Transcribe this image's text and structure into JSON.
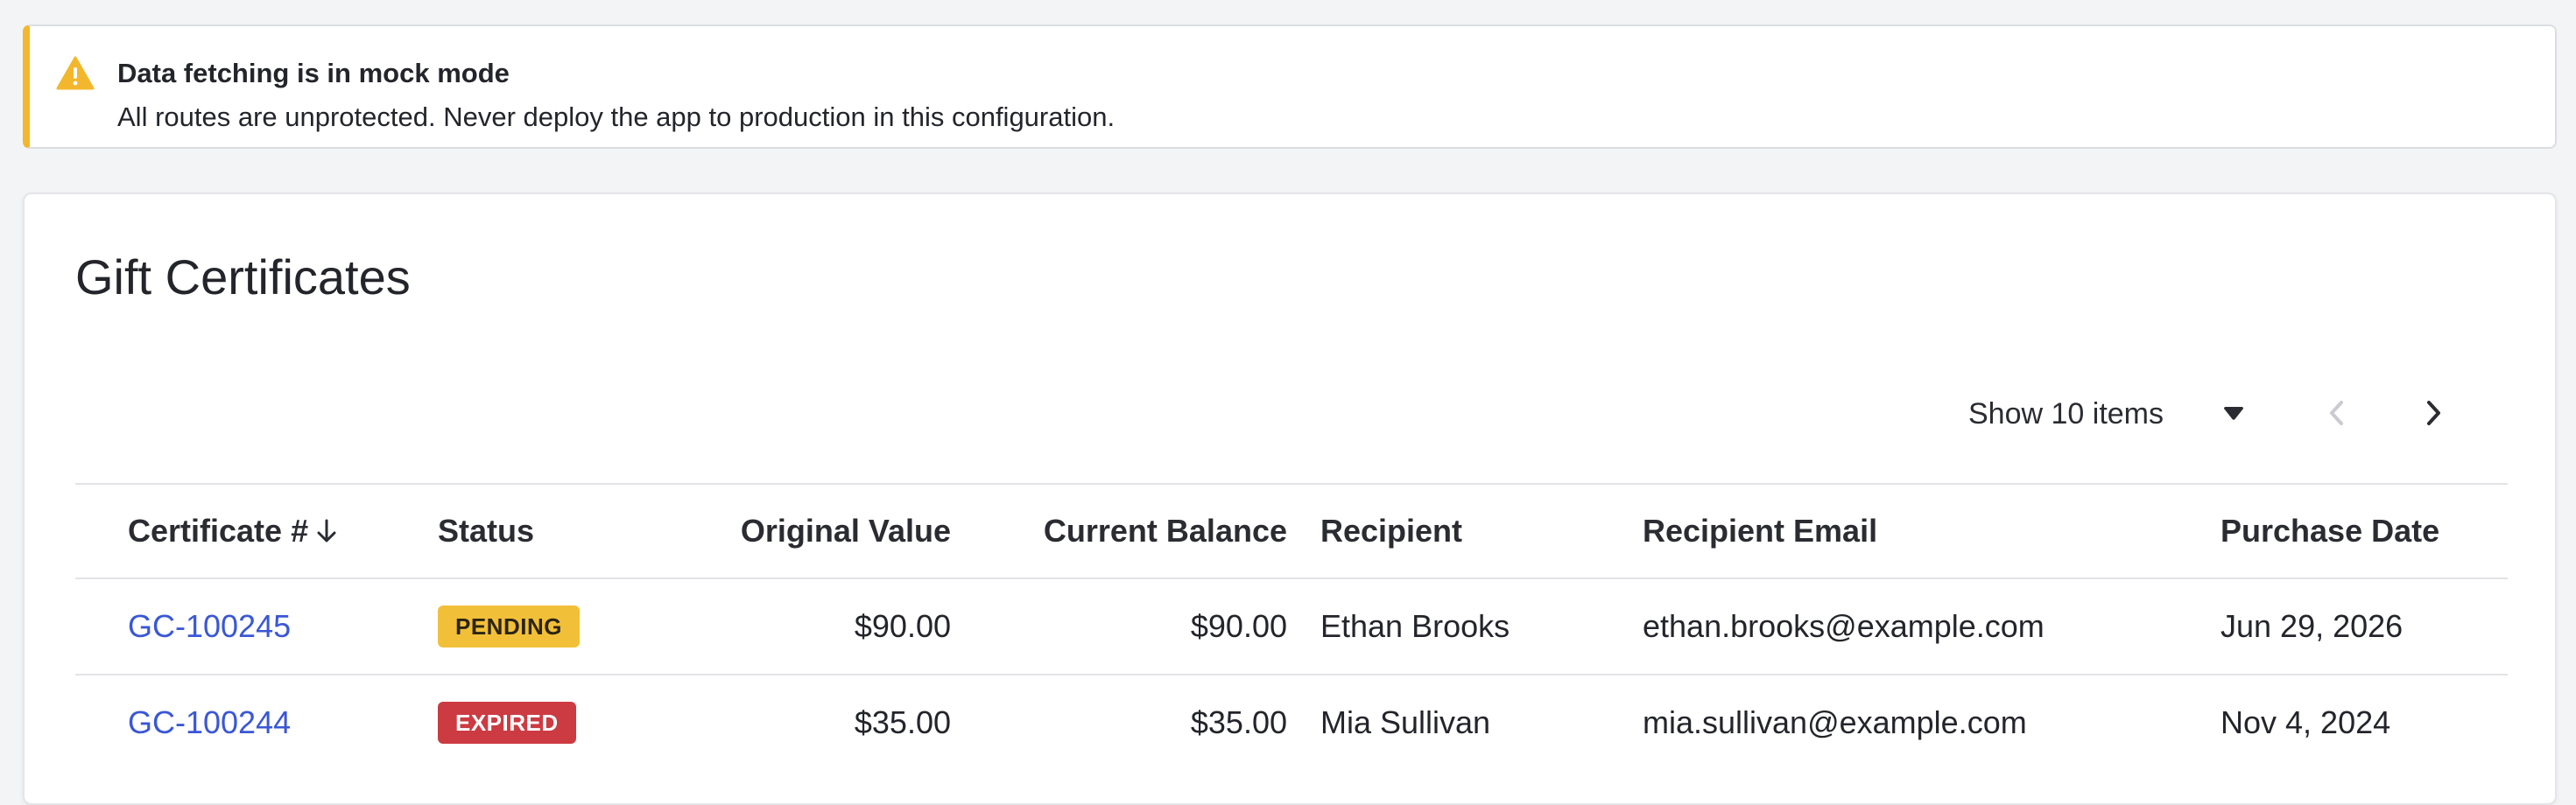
{
  "alert": {
    "title": "Data fetching is in mock mode",
    "message": "All routes are unprotected. Never deploy the app to production in this configuration.",
    "icon": "warning-icon",
    "accent_color": "#f3b72e"
  },
  "page": {
    "title": "Gift Certificates"
  },
  "pager": {
    "page_size_label": "Show 10 items",
    "prev_icon": "chevron-left-icon",
    "next_icon": "chevron-right-icon",
    "caret_icon": "caret-down-icon"
  },
  "table": {
    "columns": {
      "certificate": "Certificate #",
      "status": "Status",
      "original_value": "Original Value",
      "current_balance": "Current Balance",
      "recipient": "Recipient",
      "recipient_email": "Recipient Email",
      "purchase_date": "Purchase Date"
    },
    "sort_icon": "arrow-down-icon",
    "rows": [
      {
        "certificate": "GC-100245",
        "status": "PENDING",
        "original_value": "$90.00",
        "current_balance": "$90.00",
        "recipient": "Ethan Brooks",
        "recipient_email": "ethan.brooks@example.com",
        "purchase_date": "Jun 29, 2026"
      },
      {
        "certificate": "GC-100244",
        "status": "EXPIRED",
        "original_value": "$35.00",
        "current_balance": "$35.00",
        "recipient": "Mia Sullivan",
        "recipient_email": "mia.sullivan@example.com",
        "purchase_date": "Nov 4, 2024"
      }
    ]
  },
  "colors": {
    "link": "#3a57d6",
    "pending_badge": "#f2c038",
    "expired_badge": "#cc3b42"
  }
}
